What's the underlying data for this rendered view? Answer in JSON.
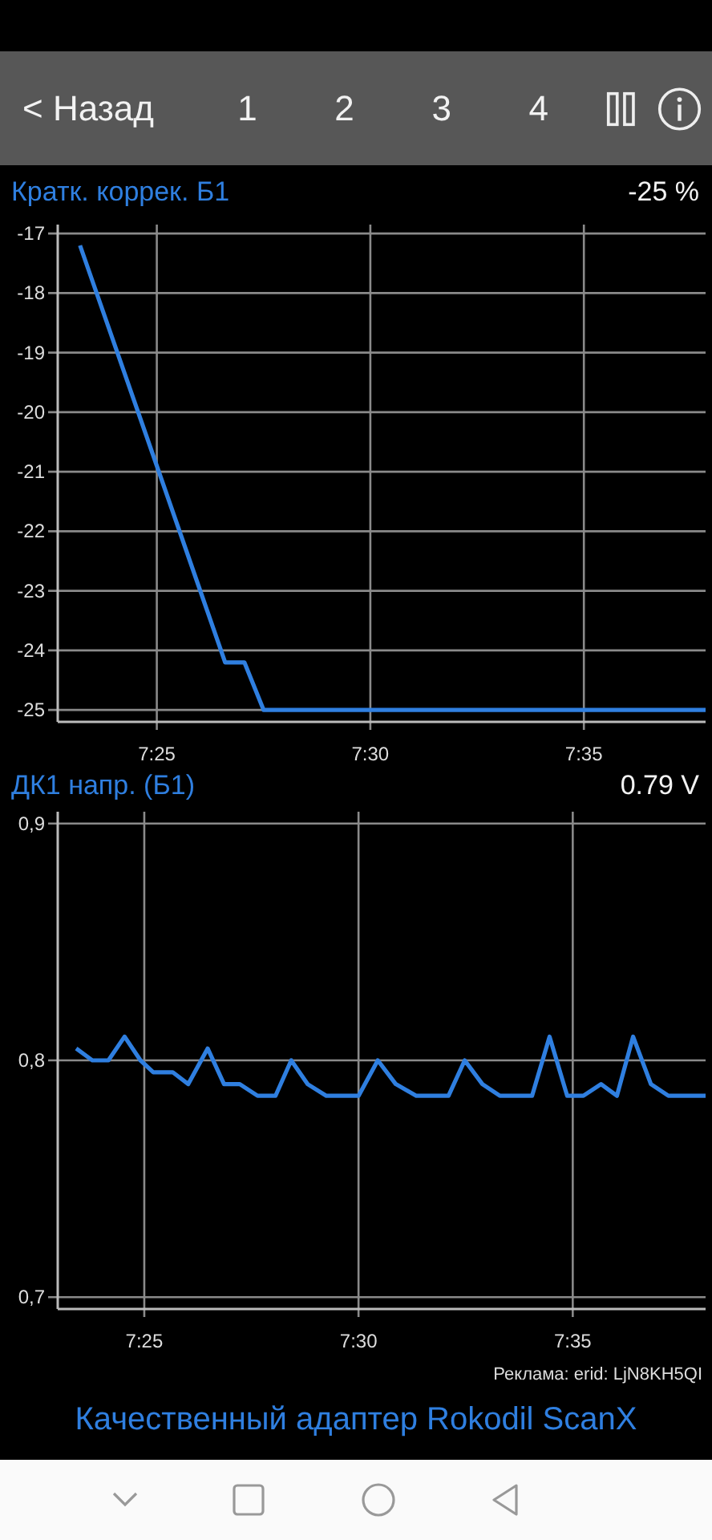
{
  "toolbar": {
    "back": "< Назад",
    "pages": [
      "1",
      "2",
      "3",
      "4"
    ]
  },
  "charts": [
    {
      "title": "Кратк. коррек. Б1",
      "reading": "-25 %",
      "chart_data": {
        "type": "line",
        "grid": true,
        "xlim": [
          7.378,
          7.63083
        ],
        "ylim": [
          -25.2,
          -16.85
        ],
        "xticks": [
          {
            "value": 7.416667,
            "label": "7:25"
          },
          {
            "value": 7.5,
            "label": "7:30"
          },
          {
            "value": 7.583333,
            "label": "7:35"
          }
        ],
        "yticks": [
          -17,
          -18,
          -19,
          -20,
          -21,
          -22,
          -23,
          -24,
          -25
        ],
        "series": [
          {
            "color": "#2f7fe0",
            "x": [
              7.38667,
              7.41667,
              7.44333,
              7.45083,
              7.45833,
              7.63083
            ],
            "values": [
              -17.2,
              -20.9,
              -24.2,
              -24.2,
              -25,
              -25
            ]
          }
        ]
      }
    },
    {
      "title": "ДК1 напр. (Б1)",
      "reading": "0.79 V",
      "chart_data": {
        "type": "line",
        "grid": true,
        "xlim": [
          7.383,
          7.635
        ],
        "ylim": [
          0.695,
          0.905
        ],
        "xticks": [
          {
            "value": 7.416667,
            "label": "7:25"
          },
          {
            "value": 7.5,
            "label": "7:30"
          },
          {
            "value": 7.583333,
            "label": "7:35"
          }
        ],
        "yticks": [
          {
            "value": 0.9,
            "label": "0,9"
          },
          {
            "value": 0.8,
            "label": "0,8"
          },
          {
            "value": 0.7,
            "label": "0,7"
          }
        ],
        "series": [
          {
            "color": "#2f7fe0",
            "x": [
              7.3902,
              7.3965,
              7.4027,
              7.409,
              7.4152,
              7.4202,
              7.4277,
              7.4338,
              7.4413,
              7.4477,
              7.4538,
              7.4607,
              7.4677,
              7.4738,
              7.4802,
              7.4875,
              7.5,
              7.5075,
              7.5145,
              7.5225,
              7.535,
              7.5413,
              7.5482,
              7.555,
              7.5675,
              7.5743,
              7.5812,
              7.5875,
              7.5943,
              7.6005,
              7.6068,
              7.6137,
              7.6205,
              7.635
            ],
            "values": [
              0.805,
              0.8,
              0.8,
              0.81,
              0.8,
              0.795,
              0.795,
              0.79,
              0.805,
              0.79,
              0.79,
              0.785,
              0.785,
              0.8,
              0.79,
              0.785,
              0.785,
              0.8,
              0.79,
              0.785,
              0.785,
              0.8,
              0.79,
              0.785,
              0.785,
              0.81,
              0.785,
              0.785,
              0.79,
              0.785,
              0.81,
              0.79,
              0.785,
              0.785
            ]
          }
        ]
      }
    }
  ],
  "ad": {
    "label": "Реклама: erid: LjN8KH5QI",
    "link": "Качественный адаптер Rokodil ScanX"
  }
}
